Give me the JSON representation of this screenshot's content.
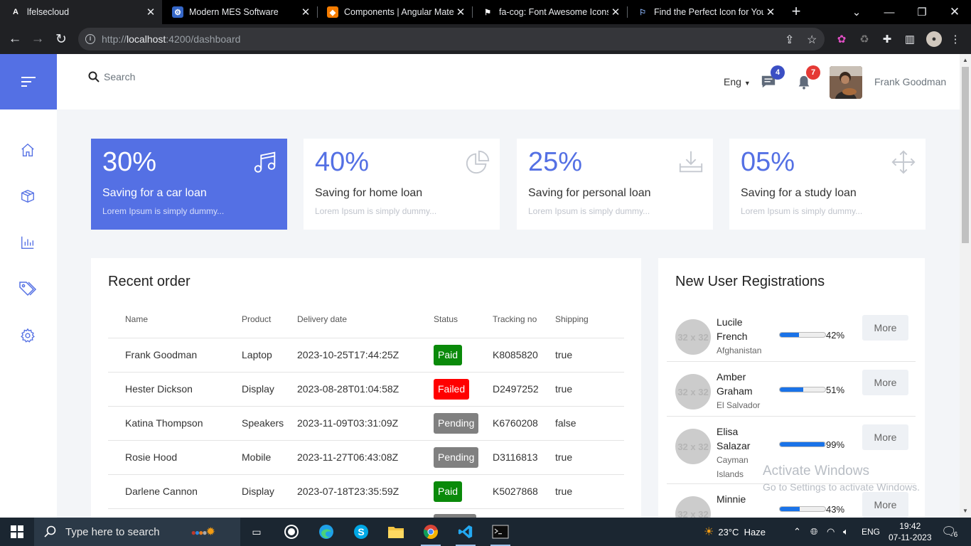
{
  "browser": {
    "tabs": [
      {
        "title": "lfelsecloud",
        "active": true
      },
      {
        "title": "Modern MES Software",
        "active": false
      },
      {
        "title": "Components | Angular Mate",
        "active": false
      },
      {
        "title": "fa-cog: Font Awesome Icons",
        "active": false
      },
      {
        "title": "Find the Perfect Icon for You",
        "active": false
      }
    ],
    "url_prefix": "http://",
    "url_host": "localhost",
    "url_rest": ":4200/dashboard"
  },
  "topbar": {
    "search_placeholder": "Search",
    "language": "Eng",
    "messages_count": "4",
    "notifications_count": "7",
    "user_name": "Frank Goodman",
    "messages_color": "#3b4fc4",
    "notifications_color": "#e53935"
  },
  "sidebar": {
    "items": [
      "home-icon",
      "box-icon",
      "bar-chart-icon",
      "tags-icon",
      "gear-icon"
    ],
    "accent": "#5470e4"
  },
  "stat_cards": [
    {
      "percent": "30%",
      "label": "Saving for a car loan",
      "sub": "Lorem Ipsum is simply dummy...",
      "icon": "music-icon"
    },
    {
      "percent": "40%",
      "label": "Saving for home loan",
      "sub": "Lorem Ipsum is simply dummy...",
      "icon": "pie-chart-icon"
    },
    {
      "percent": "25%",
      "label": "Saving for personal loan",
      "sub": "Lorem Ipsum is simply dummy...",
      "icon": "download-icon"
    },
    {
      "percent": "05%",
      "label": "Saving for a study loan",
      "sub": "Lorem Ipsum is simply dummy...",
      "icon": "move-icon"
    }
  ],
  "recent_order": {
    "title": "Recent order",
    "columns": [
      "Name",
      "Product",
      "Delivery date",
      "Status",
      "Tracking no",
      "Shipping"
    ],
    "rows": [
      {
        "name": "Frank Goodman",
        "product": "Laptop",
        "date": "2023-10-25T17:44:25Z",
        "status": "Paid",
        "status_color": "#0a8a0a",
        "tracking": "K8085820",
        "shipping": "true"
      },
      {
        "name": "Hester Dickson",
        "product": "Display",
        "date": "2023-08-28T01:04:58Z",
        "status": "Failed",
        "status_color": "#ff0000",
        "tracking": "D2497252",
        "shipping": "true"
      },
      {
        "name": "Katina Thompson",
        "product": "Speakers",
        "date": "2023-11-09T03:31:09Z",
        "status": "Pending",
        "status_color": "#808080",
        "tracking": "K6760208",
        "shipping": "false"
      },
      {
        "name": "Rosie Hood",
        "product": "Mobile",
        "date": "2023-11-27T06:43:08Z",
        "status": "Pending",
        "status_color": "#808080",
        "tracking": "D3116813",
        "shipping": "true"
      },
      {
        "name": "Darlene Cannon",
        "product": "Display",
        "date": "2023-07-18T23:35:59Z",
        "status": "Paid",
        "status_color": "#0a8a0a",
        "tracking": "K5027868",
        "shipping": "true"
      }
    ]
  },
  "registrations": {
    "title": "New User Registrations",
    "placeholder": "32 x 32",
    "more_label": "More",
    "users": [
      {
        "first": "Lucile",
        "last": "French",
        "country": "Afghanistan",
        "percent": "42%",
        "value": 0.42
      },
      {
        "first": "Amber",
        "last": "Graham",
        "country": "El Salvador",
        "percent": "51%",
        "value": 0.51
      },
      {
        "first": "Elisa",
        "last": "Salazar",
        "country": "Cayman Islands",
        "percent": "99%",
        "value": 0.99
      },
      {
        "first": "Minnie",
        "last": "",
        "country": "",
        "percent": "43%",
        "value": 0.43
      }
    ]
  },
  "watermark": {
    "line1": "Activate Windows",
    "line2": "Go to Settings to activate Windows."
  },
  "taskbar": {
    "search_placeholder": "Type here to search",
    "weather_temp": "23°C",
    "weather_desc": "Haze",
    "language": "ENG",
    "time": "19:42",
    "date": "07-11-2023",
    "notification_count": "6"
  }
}
